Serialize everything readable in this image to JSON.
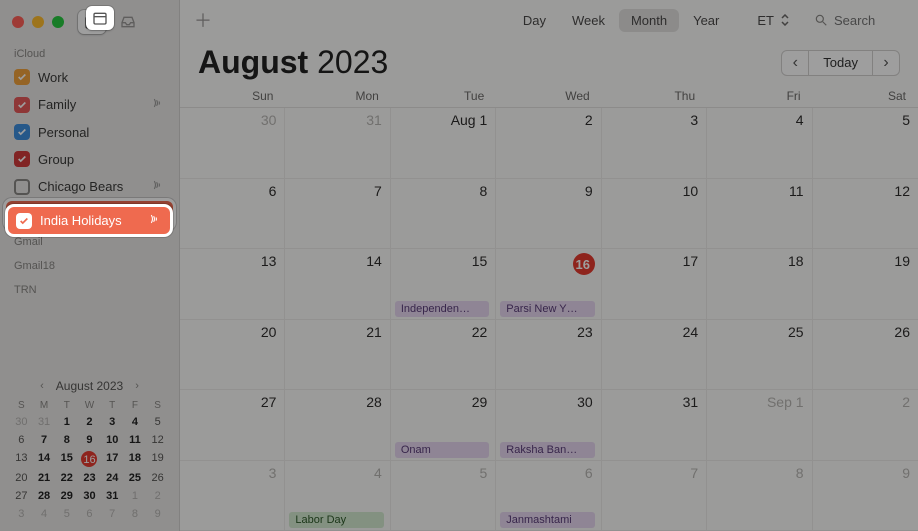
{
  "window": {
    "title": "Calendar"
  },
  "sidebar": {
    "sections": [
      {
        "label": "iCloud",
        "items": [
          {
            "name": "Work",
            "color": "#f0a23c",
            "checked": true,
            "shared": false
          },
          {
            "name": "Family",
            "color": "#e65a5a",
            "checked": true,
            "shared": true
          },
          {
            "name": "Personal",
            "color": "#3e8ede",
            "checked": true,
            "shared": false
          },
          {
            "name": "Group",
            "color": "#d13a3a",
            "checked": true,
            "shared": false
          },
          {
            "name": "Chicago Bears",
            "color": "#8a8885",
            "checked": false,
            "shared": true
          },
          {
            "name": "India Holidays",
            "color": "#ef6a4f",
            "checked": true,
            "shared": true,
            "selected": true
          }
        ]
      },
      {
        "label": "Gmail",
        "items": []
      },
      {
        "label": "Gmail18",
        "items": []
      },
      {
        "label": "TRN",
        "items": []
      }
    ]
  },
  "mini_calendar": {
    "title": "August 2023",
    "dow": [
      "S",
      "M",
      "T",
      "W",
      "T",
      "F",
      "S"
    ],
    "weeks": [
      [
        {
          "n": 30,
          "muted": true
        },
        {
          "n": 31,
          "muted": true
        },
        {
          "n": 1,
          "bold": true
        },
        {
          "n": 2,
          "bold": true
        },
        {
          "n": 3,
          "bold": true
        },
        {
          "n": 4,
          "bold": true
        },
        {
          "n": 5
        }
      ],
      [
        {
          "n": 6
        },
        {
          "n": 7,
          "bold": true
        },
        {
          "n": 8,
          "bold": true
        },
        {
          "n": 9,
          "bold": true
        },
        {
          "n": 10,
          "bold": true
        },
        {
          "n": 11,
          "bold": true
        },
        {
          "n": 12
        }
      ],
      [
        {
          "n": 13
        },
        {
          "n": 14,
          "bold": true
        },
        {
          "n": 15,
          "bold": true
        },
        {
          "n": 16,
          "today": true
        },
        {
          "n": 17,
          "bold": true
        },
        {
          "n": 18,
          "bold": true
        },
        {
          "n": 19
        }
      ],
      [
        {
          "n": 20
        },
        {
          "n": 21,
          "bold": true
        },
        {
          "n": 22,
          "bold": true
        },
        {
          "n": 23,
          "bold": true
        },
        {
          "n": 24,
          "bold": true
        },
        {
          "n": 25,
          "bold": true
        },
        {
          "n": 26
        }
      ],
      [
        {
          "n": 27
        },
        {
          "n": 28,
          "bold": true
        },
        {
          "n": 29,
          "bold": true
        },
        {
          "n": 30,
          "bold": true
        },
        {
          "n": 31,
          "bold": true
        },
        {
          "n": 1,
          "muted": true
        },
        {
          "n": 2,
          "muted": true
        }
      ],
      [
        {
          "n": 3,
          "muted": true
        },
        {
          "n": 4,
          "muted": true
        },
        {
          "n": 5,
          "muted": true
        },
        {
          "n": 6,
          "muted": true
        },
        {
          "n": 7,
          "muted": true
        },
        {
          "n": 8,
          "muted": true
        },
        {
          "n": 9,
          "muted": true
        }
      ]
    ]
  },
  "topbar": {
    "views": {
      "day": "Day",
      "week": "Week",
      "month": "Month",
      "year": "Year",
      "active": "Month"
    },
    "timezone": "ET",
    "search_placeholder": "Search"
  },
  "header": {
    "month": "August",
    "year": "2023",
    "today_label": "Today"
  },
  "dow": [
    "Sun",
    "Mon",
    "Tue",
    "Wed",
    "Thu",
    "Fri",
    "Sat"
  ],
  "cells": [
    {
      "label": "30",
      "muted": true
    },
    {
      "label": "31",
      "muted": true
    },
    {
      "label": "Aug 1"
    },
    {
      "label": "2"
    },
    {
      "label": "3"
    },
    {
      "label": "4"
    },
    {
      "label": "5"
    },
    {
      "label": "6"
    },
    {
      "label": "7"
    },
    {
      "label": "8"
    },
    {
      "label": "9"
    },
    {
      "label": "10"
    },
    {
      "label": "11"
    },
    {
      "label": "12"
    },
    {
      "label": "13"
    },
    {
      "label": "14"
    },
    {
      "label": "15",
      "events": [
        {
          "t": "Independen…",
          "c": "purple"
        }
      ]
    },
    {
      "label": "16",
      "today": true,
      "events": [
        {
          "t": "Parsi New Y…",
          "c": "purple"
        }
      ]
    },
    {
      "label": "17"
    },
    {
      "label": "18"
    },
    {
      "label": "19"
    },
    {
      "label": "20"
    },
    {
      "label": "21"
    },
    {
      "label": "22"
    },
    {
      "label": "23"
    },
    {
      "label": "24"
    },
    {
      "label": "25"
    },
    {
      "label": "26"
    },
    {
      "label": "27"
    },
    {
      "label": "28"
    },
    {
      "label": "29",
      "events": [
        {
          "t": "Onam",
          "c": "purple"
        }
      ]
    },
    {
      "label": "30",
      "events": [
        {
          "t": "Raksha Ban…",
          "c": "purple"
        }
      ]
    },
    {
      "label": "31"
    },
    {
      "label": "Sep 1",
      "muted": true
    },
    {
      "label": "2",
      "muted": true
    },
    {
      "label": "3",
      "muted": true
    },
    {
      "label": "4",
      "muted": true,
      "events": [
        {
          "t": "Labor Day",
          "c": "green"
        }
      ]
    },
    {
      "label": "5",
      "muted": true
    },
    {
      "label": "6",
      "muted": true,
      "events": [
        {
          "t": "Janmashtami",
          "c": "purple"
        }
      ]
    },
    {
      "label": "7",
      "muted": true
    },
    {
      "label": "8",
      "muted": true
    },
    {
      "label": "9",
      "muted": true
    }
  ]
}
